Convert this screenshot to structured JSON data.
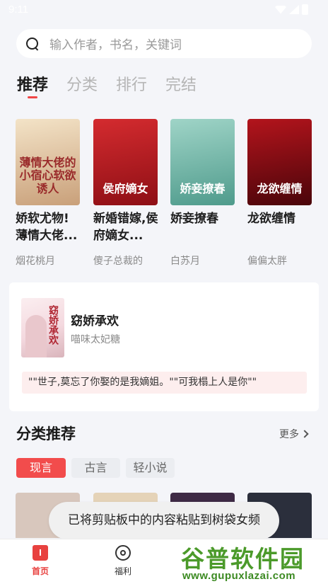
{
  "status_bar": {
    "time": "9:11"
  },
  "search": {
    "placeholder": "输入作者，书名，关键词"
  },
  "tabs": [
    {
      "label": "推荐",
      "active": true
    },
    {
      "label": "分类",
      "active": false
    },
    {
      "label": "排行",
      "active": false
    },
    {
      "label": "完结",
      "active": false
    }
  ],
  "books": [
    {
      "title": "娇软尤物!薄情大佬...",
      "author": "烟花桃月",
      "cover_text": "薄情大佬的小宿心软欲诱人",
      "cover_colors": [
        "#f3e3c7",
        "#c9a07a"
      ],
      "cover_text_color": "#9a2b2b"
    },
    {
      "title": "新婚错嫁,侯府嫡女...",
      "author": "傻子总裁的",
      "cover_text": "侯府嫡女",
      "cover_colors": [
        "#d42b2f",
        "#8e0f15"
      ],
      "cover_text_color": "#ffffff"
    },
    {
      "title": "娇妾撩春",
      "author": "白苏月",
      "cover_text": "娇妾撩春",
      "cover_colors": [
        "#9fd4c7",
        "#4f9b8c"
      ],
      "cover_text_color": "#ffffff"
    },
    {
      "title": "龙欲缠情",
      "author": "偏偏太胖",
      "cover_text": "龙欲缠情",
      "cover_colors": [
        "#b3141c",
        "#4a050a"
      ],
      "cover_text_color": "#ffffff"
    }
  ],
  "featured": {
    "title": "窈娇承欢",
    "author": "喵味太妃糖",
    "cover_text": "窈娇承欢",
    "quote": "\"\"世子,莫忘了你娶的是我嫡姐。\"\"可我榻上人是你\"\""
  },
  "category_section": {
    "title": "分类推荐",
    "more_label": "更多",
    "pills": [
      {
        "label": "现言",
        "active": true
      },
      {
        "label": "古言",
        "active": false
      },
      {
        "label": "轻小说",
        "active": false
      }
    ],
    "strip_colors": [
      "#d8c7bd",
      "#e5d3b8",
      "#3e2a45",
      "#2b2f3c"
    ]
  },
  "toast": {
    "message": "已将剪贴板中的内容粘贴到树袋女频"
  },
  "bottom_nav": [
    {
      "label": "首页",
      "icon": "home-icon",
      "active": true
    },
    {
      "label": "福利",
      "icon": "welfare-icon",
      "active": false
    }
  ],
  "watermark": {
    "brand": "谷普软件园",
    "url": "www.gupuxlazai.com"
  },
  "colors": {
    "accent": "#f04646",
    "background": "#f4f5f9"
  }
}
